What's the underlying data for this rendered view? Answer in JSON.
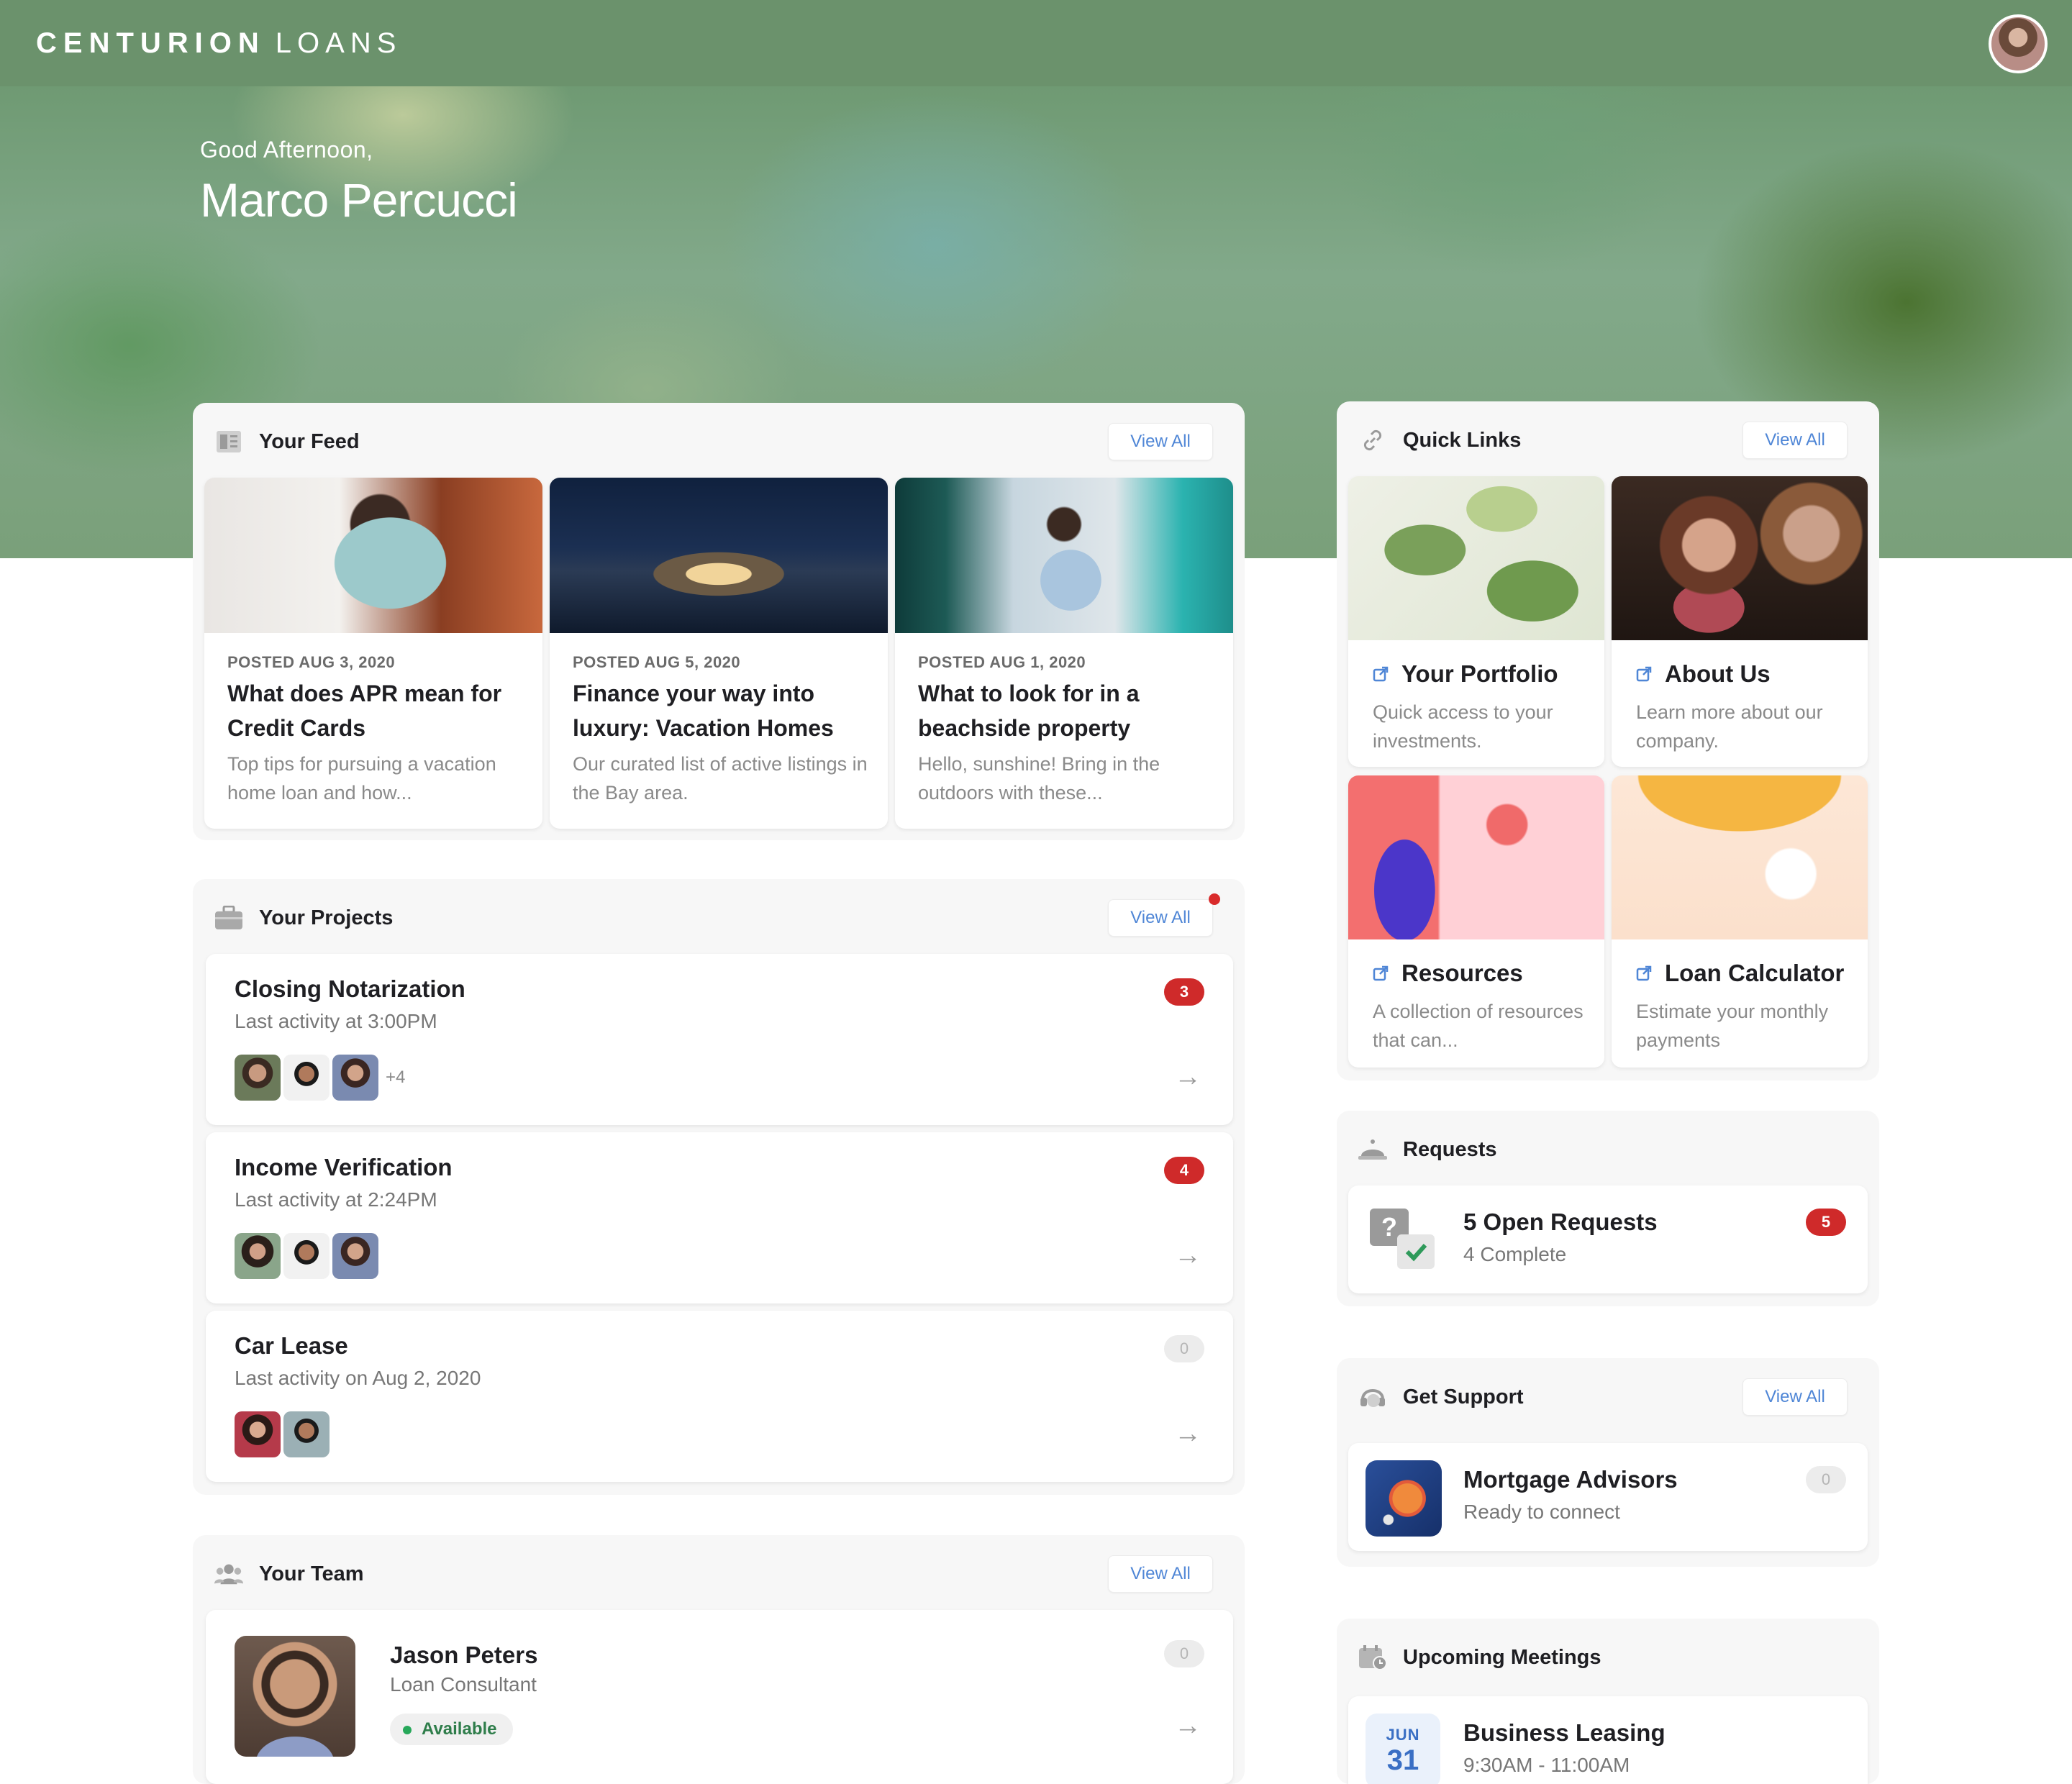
{
  "brand": {
    "bold": "CENTURION",
    "light": "LOANS"
  },
  "hero": {
    "greeting": "Good Afternoon,",
    "name": "Marco Percucci"
  },
  "feed": {
    "title": "Your Feed",
    "view_all": "View All",
    "items": [
      {
        "posted": "POSTED AUG 3, 2020",
        "title": "What does APR mean for Credit Cards",
        "desc": "Top tips for pursuing a vacation home loan and how..."
      },
      {
        "posted": "POSTED AUG 5, 2020",
        "title": "Finance your way into luxury: Vacation Homes",
        "desc": "Our curated list of active listings in the Bay area."
      },
      {
        "posted": "POSTED AUG 1, 2020",
        "title": "What to look for in a beachside property",
        "desc": "Hello, sunshine! Bring in the outdoors with these..."
      }
    ]
  },
  "projects": {
    "title": "Your Projects",
    "view_all": "View All",
    "items": [
      {
        "title": "Closing Notarization",
        "sub": "Last activity at 3:00PM",
        "count": "3",
        "more": "+4"
      },
      {
        "title": "Income Verification",
        "sub": "Last activity at 2:24PM",
        "count": "4",
        "more": ""
      },
      {
        "title": "Car Lease",
        "sub": "Last activity on Aug 2, 2020",
        "count": "0",
        "more": ""
      }
    ]
  },
  "team": {
    "title": "Your Team",
    "view_all": "View All",
    "member": {
      "name": "Jason Peters",
      "role": "Loan Consultant",
      "status": "Available",
      "count": "0"
    }
  },
  "quick_links": {
    "title": "Quick Links",
    "view_all": "View All",
    "items": [
      {
        "title": "Your Portfolio",
        "desc": "Quick access to your investments."
      },
      {
        "title": "About Us",
        "desc": "Learn more about our company."
      },
      {
        "title": "Resources",
        "desc": "A collection of resources that can..."
      },
      {
        "title": "Loan Calculator",
        "desc": "Estimate your monthly payments"
      }
    ]
  },
  "requests": {
    "title": "Requests",
    "item": {
      "title": "5 Open Requests",
      "sub": "4 Complete",
      "count": "5"
    }
  },
  "support": {
    "title": "Get Support",
    "view_all": "View All",
    "item": {
      "title": "Mortgage Advisors",
      "sub": "Ready to connect",
      "count": "0"
    }
  },
  "meetings": {
    "title": "Upcoming Meetings",
    "item": {
      "month": "JUN",
      "day": "31",
      "title": "Business Leasing",
      "time": "9:30AM - 11:00AM"
    }
  },
  "colors": {
    "header": "#6b926c",
    "accent_blue": "#4f86d6",
    "badge_red": "#cf2a2a",
    "status_green": "#27a85a"
  },
  "icons": [
    "avatar",
    "newspaper-icon",
    "briefcase-icon",
    "team-icon",
    "link-icon",
    "external-link-icon",
    "bell-icon",
    "headset-icon",
    "calendar-icon",
    "arrow-right-icon",
    "question-check-icon"
  ]
}
